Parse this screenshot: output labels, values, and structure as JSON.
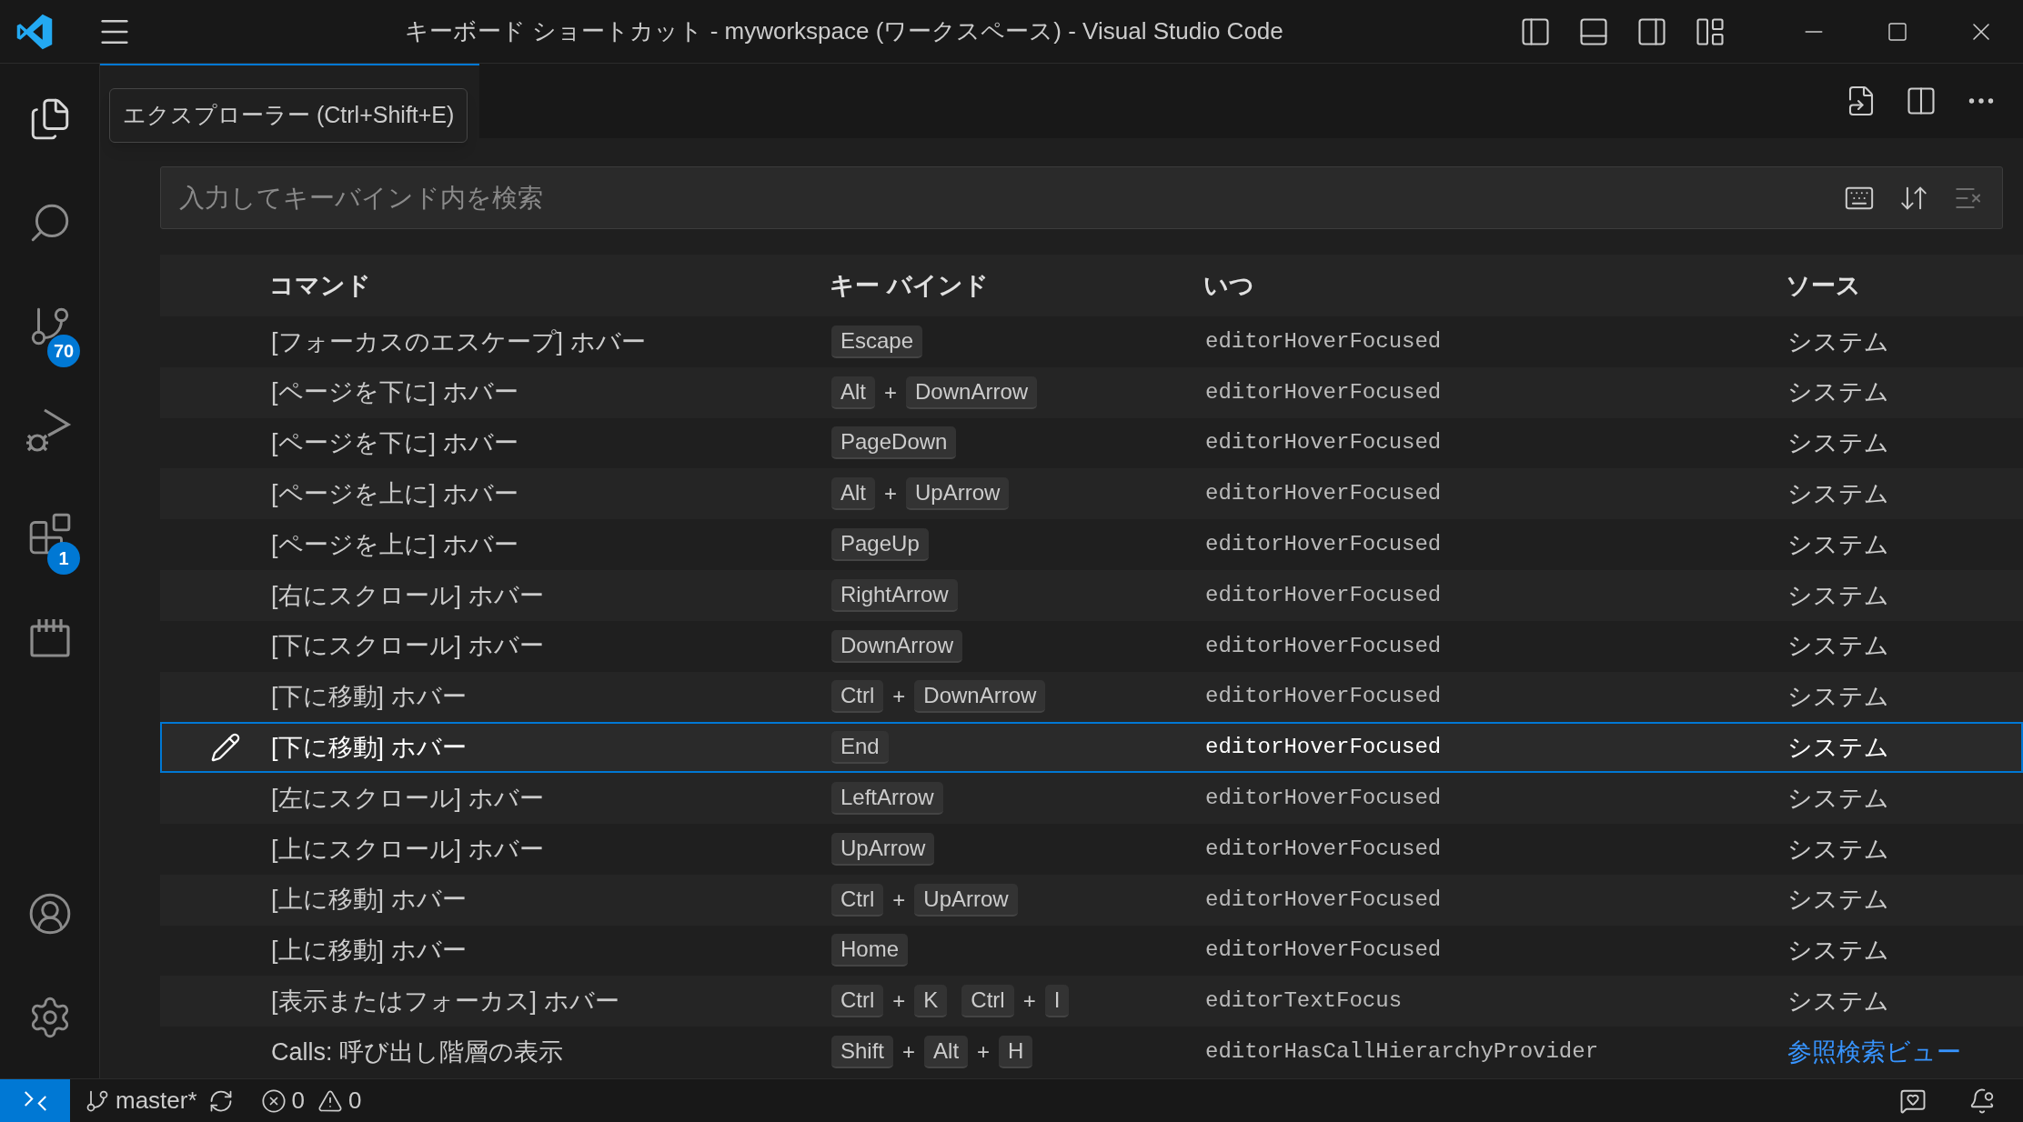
{
  "window": {
    "title": "キーボード ショートカット - myworkspace (ワークスペース) - Visual Studio Code"
  },
  "activity_bar": {
    "items": [
      {
        "kind": "files"
      },
      {
        "kind": "search"
      },
      {
        "kind": "scm",
        "badge": "70"
      },
      {
        "kind": "run"
      },
      {
        "kind": "extensions",
        "badge": "1"
      },
      {
        "kind": "box"
      }
    ],
    "bottom_items": [
      {
        "kind": "account"
      },
      {
        "kind": "settings"
      }
    ]
  },
  "tooltip": {
    "text": "エクスプローラー (Ctrl+Shift+E)"
  },
  "search": {
    "placeholder": "入力してキーバインド内を検索"
  },
  "table": {
    "columns": [
      "コマンド",
      "キー バインド",
      "いつ",
      "ソース"
    ],
    "rows": [
      {
        "command": "[フォーカスのエスケープ] ホバー",
        "keybinding": [
          [
            "Escape"
          ]
        ],
        "when": "editorHoverFocused",
        "source": "システム",
        "source_link": false,
        "selected": false
      },
      {
        "command": "[ページを下に] ホバー",
        "keybinding": [
          [
            "Alt",
            "+",
            "DownArrow"
          ]
        ],
        "when": "editorHoverFocused",
        "source": "システム",
        "source_link": false,
        "selected": false
      },
      {
        "command": "[ページを下に] ホバー",
        "keybinding": [
          [
            "PageDown"
          ]
        ],
        "when": "editorHoverFocused",
        "source": "システム",
        "source_link": false,
        "selected": false
      },
      {
        "command": "[ページを上に] ホバー",
        "keybinding": [
          [
            "Alt",
            "+",
            "UpArrow"
          ]
        ],
        "when": "editorHoverFocused",
        "source": "システム",
        "source_link": false,
        "selected": false
      },
      {
        "command": "[ページを上に] ホバー",
        "keybinding": [
          [
            "PageUp"
          ]
        ],
        "when": "editorHoverFocused",
        "source": "システム",
        "source_link": false,
        "selected": false
      },
      {
        "command": "[右にスクロール] ホバー",
        "keybinding": [
          [
            "RightArrow"
          ]
        ],
        "when": "editorHoverFocused",
        "source": "システム",
        "source_link": false,
        "selected": false
      },
      {
        "command": "[下にスクロール] ホバー",
        "keybinding": [
          [
            "DownArrow"
          ]
        ],
        "when": "editorHoverFocused",
        "source": "システム",
        "source_link": false,
        "selected": false
      },
      {
        "command": "[下に移動] ホバー",
        "keybinding": [
          [
            "Ctrl",
            "+",
            "DownArrow"
          ]
        ],
        "when": "editorHoverFocused",
        "source": "システム",
        "source_link": false,
        "selected": false
      },
      {
        "command": "[下に移動] ホバー",
        "keybinding": [
          [
            "End"
          ]
        ],
        "when": "editorHoverFocused",
        "source": "システム",
        "source_link": false,
        "selected": true
      },
      {
        "command": "[左にスクロール] ホバー",
        "keybinding": [
          [
            "LeftArrow"
          ]
        ],
        "when": "editorHoverFocused",
        "source": "システム",
        "source_link": false,
        "selected": false
      },
      {
        "command": "[上にスクロール] ホバー",
        "keybinding": [
          [
            "UpArrow"
          ]
        ],
        "when": "editorHoverFocused",
        "source": "システム",
        "source_link": false,
        "selected": false
      },
      {
        "command": "[上に移動] ホバー",
        "keybinding": [
          [
            "Ctrl",
            "+",
            "UpArrow"
          ]
        ],
        "when": "editorHoverFocused",
        "source": "システム",
        "source_link": false,
        "selected": false
      },
      {
        "command": "[上に移動] ホバー",
        "keybinding": [
          [
            "Home"
          ]
        ],
        "when": "editorHoverFocused",
        "source": "システム",
        "source_link": false,
        "selected": false
      },
      {
        "command": "[表示またはフォーカス] ホバー",
        "keybinding": [
          [
            "Ctrl",
            "+",
            "K"
          ],
          [
            "Ctrl",
            "+",
            "I"
          ]
        ],
        "when": "editorTextFocus",
        "source": "システム",
        "source_link": false,
        "selected": false
      },
      {
        "command": "Calls: 呼び出し階層の表示",
        "keybinding": [
          [
            "Shift",
            "+",
            "Alt",
            "+",
            "H"
          ]
        ],
        "when": "editorHasCallHierarchyProvider",
        "source": "参照検索ビュー",
        "source_link": true,
        "selected": false
      }
    ]
  },
  "status_bar": {
    "branch": "master*",
    "errors": "0",
    "warnings": "0"
  }
}
